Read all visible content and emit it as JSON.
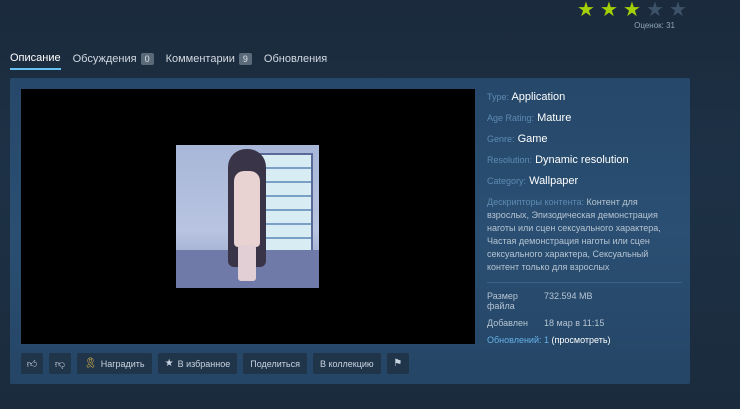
{
  "rating": {
    "stars_filled": 3,
    "stars_total": 5,
    "count_text": "Оценок: 31"
  },
  "tabs": [
    {
      "label": "Описание",
      "active": true
    },
    {
      "label": "Обсуждения",
      "badge": "0"
    },
    {
      "label": "Комментарии",
      "badge": "9"
    },
    {
      "label": "Обновления"
    }
  ],
  "details": {
    "type_label": "Type:",
    "type_value": "Application",
    "age_label": "Age Rating:",
    "age_value": "Mature",
    "genre_label": "Genre:",
    "genre_value": "Game",
    "res_label": "Resolution:",
    "res_value": "Dynamic resolution",
    "cat_label": "Category:",
    "cat_value": "Wallpaper",
    "desc_label": "Дескрипторы контента:",
    "desc_text": "Контент для взрослых, Эпизодическая демонстрация наготы или сцен сексуального характера, Частая демонстрация наготы или сцен сексуального характера, Сексуальный контент только для взрослых",
    "size_label": "Размер файла",
    "size_value": "732.594 MB",
    "added_label": "Добавлен",
    "added_value": "18 мар в 11:15",
    "updates_label": "Обновлений: 1",
    "updates_link": "(просмотреть)"
  },
  "actions": {
    "award": "Наградить",
    "favorite": "В избранное",
    "share": "Поделиться",
    "collection": "В коллекцию"
  },
  "colors": {
    "accent": "#66c0f4",
    "star": "#a4d007",
    "panel": "#284c6e"
  }
}
